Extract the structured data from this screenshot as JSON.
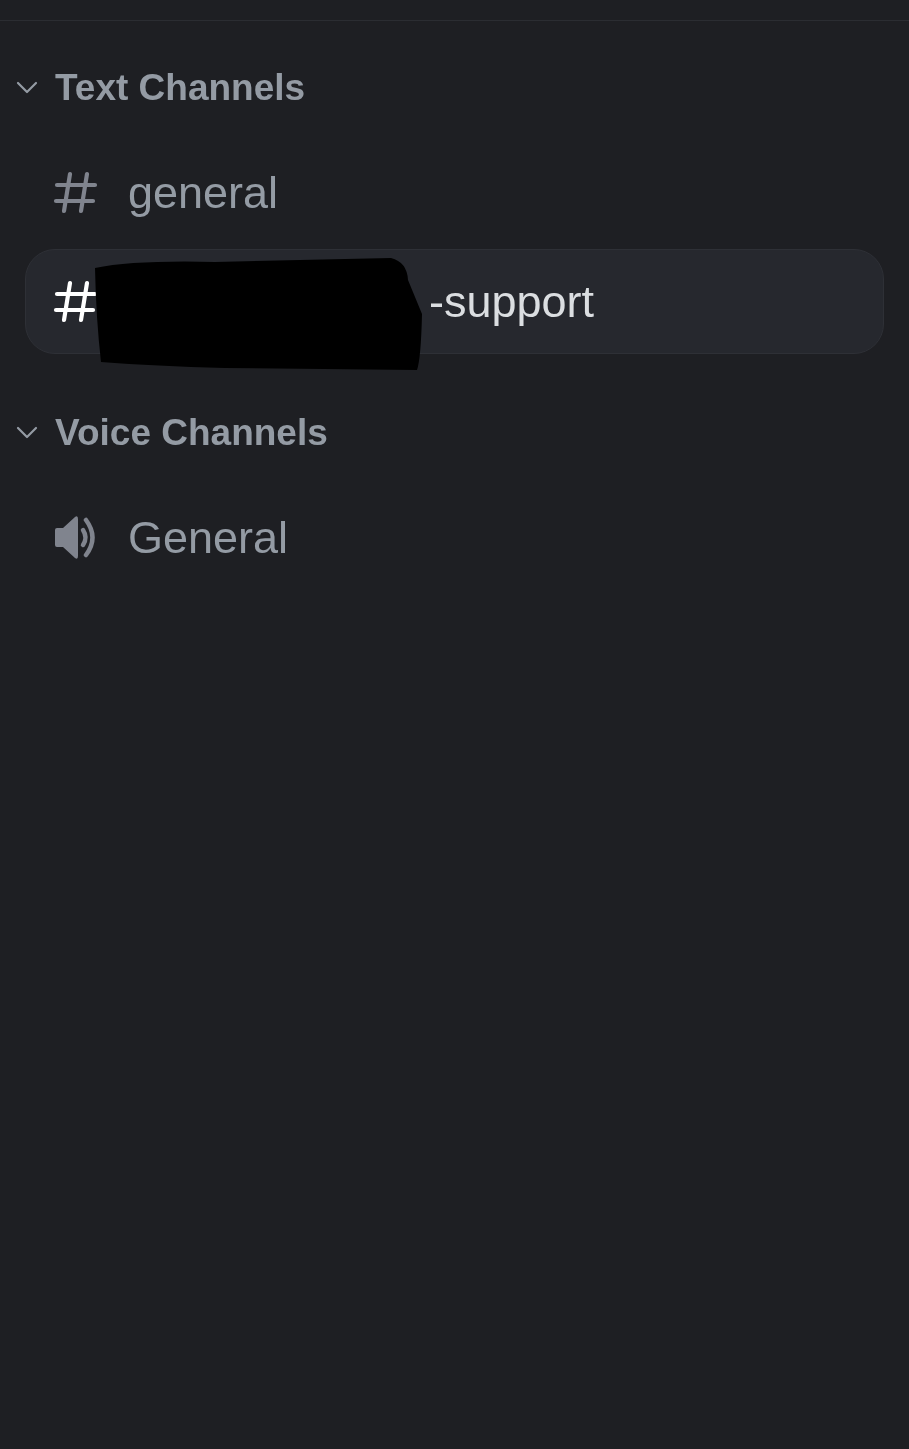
{
  "sections": [
    {
      "title": "Text Channels",
      "expanded": true,
      "channels": [
        {
          "kind": "text",
          "name": "general",
          "selected": false,
          "redacted": false
        },
        {
          "kind": "text",
          "name": "-support",
          "selected": true,
          "redacted": true
        }
      ]
    },
    {
      "title": "Voice Channels",
      "expanded": true,
      "channels": [
        {
          "kind": "voice",
          "name": "General",
          "selected": false,
          "redacted": false
        }
      ]
    }
  ]
}
